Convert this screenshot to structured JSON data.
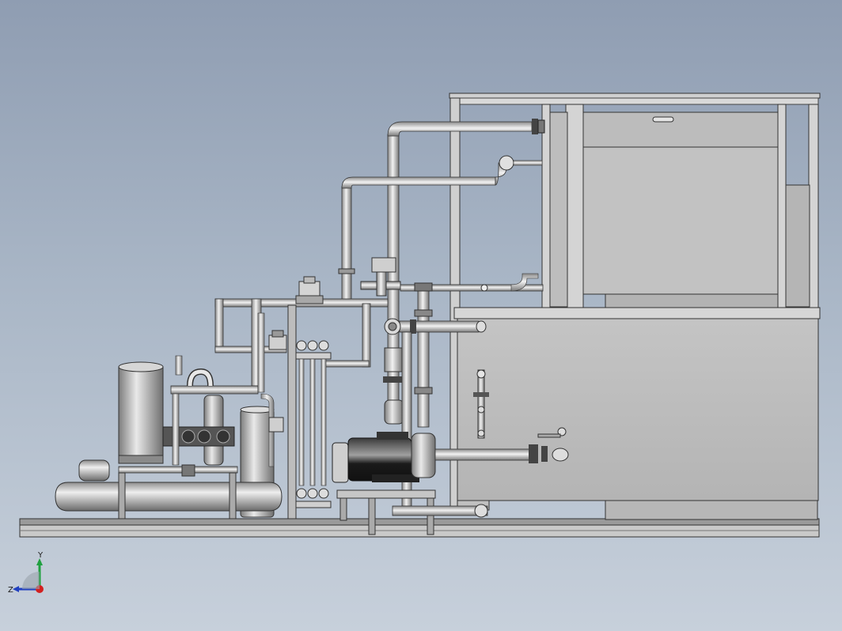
{
  "viewport": {
    "background_top": "#8f9db2",
    "background_bottom": "#c7d0db"
  },
  "triad": {
    "y_label": "Y",
    "z_label": "Z",
    "x_color": "#d22020",
    "y_color": "#20a040",
    "z_color": "#2040c0"
  },
  "model": {
    "metal_light": "#e6e6e6",
    "metal_mid": "#bdbdbd",
    "metal_dark": "#6e6e6e",
    "motor_color": "#1e1e1e"
  }
}
